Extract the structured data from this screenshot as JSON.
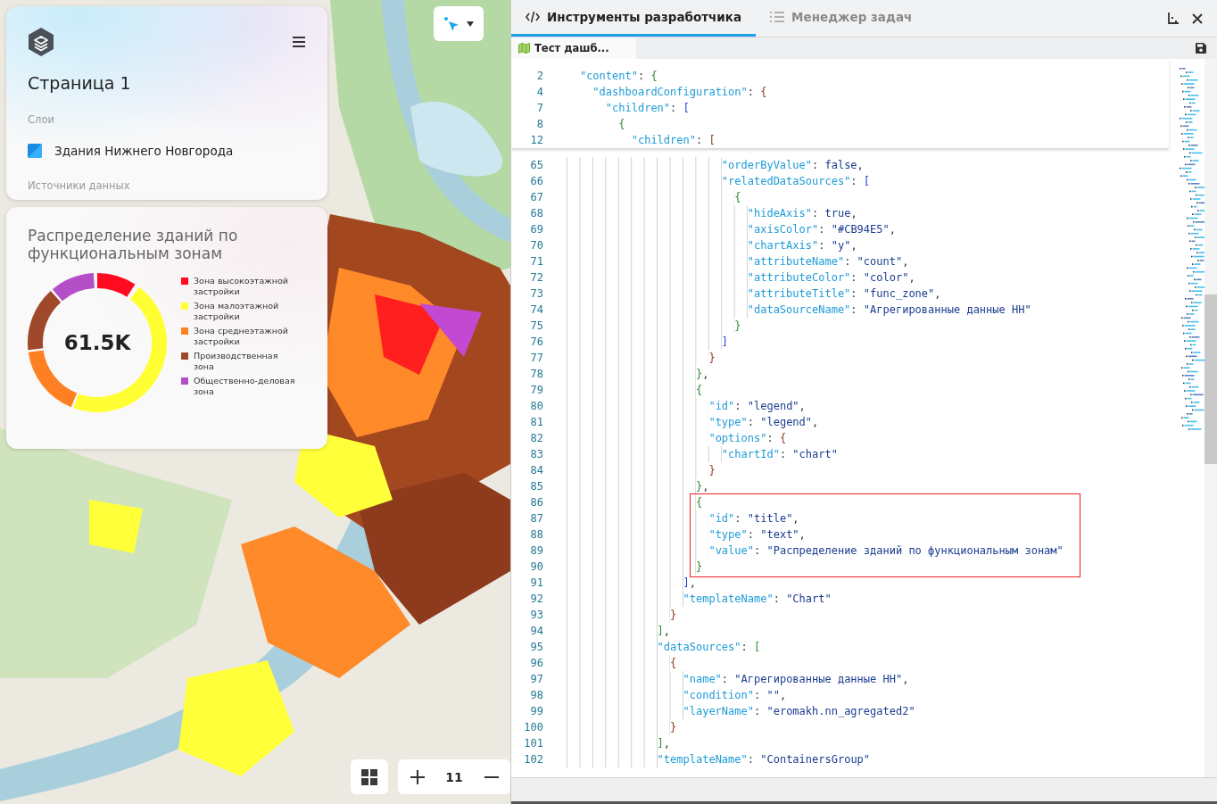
{
  "page_card": {
    "title": "Страница 1",
    "layers_label": "Слои",
    "layers": [
      {
        "name": "Здания Нижнего Новгорода"
      }
    ],
    "sources_label": "Источники данных"
  },
  "chart_card": {
    "title": "Распределение зданий по функциональным зонам",
    "total": "61.5K",
    "legend": [
      {
        "label": "Зона высокоэтажной застройки",
        "color": "#ff0a1e"
      },
      {
        "label": "Зона малоэтажной застройки",
        "color": "#ffff33"
      },
      {
        "label": "Зона среднеэтажной застройки",
        "color": "#ff8022"
      },
      {
        "label": "Производственная зона",
        "color": "#a0482a"
      },
      {
        "label": "Общественно-деловая зона",
        "color": "#b44fc8"
      }
    ]
  },
  "map_controls": {
    "zoom": "11"
  },
  "devtools": {
    "tabs": [
      {
        "label": "Инструменты разработчика",
        "kind": "code",
        "selected": true
      },
      {
        "label": "Менеджер задач",
        "kind": "list",
        "selected": false
      }
    ],
    "file_tabs": [
      {
        "label": "Тест дашб...",
        "selected": true
      }
    ],
    "sticky_lines": [
      {
        "n": "2",
        "code": "    \"content\": {"
      },
      {
        "n": "4",
        "code": "      \"dashboardConfiguration\": {"
      },
      {
        "n": "7",
        "code": "        \"children\": ["
      },
      {
        "n": "8",
        "code": "          {"
      },
      {
        "n": "12",
        "code": "            \"children\": ["
      }
    ],
    "lines": [
      {
        "n": "65",
        "code": "                          \"orderByValue\": false,",
        "highlighted": false
      },
      {
        "n": "66",
        "code": "                          \"relatedDataSources\": [",
        "highlighted": false
      },
      {
        "n": "67",
        "code": "                            {",
        "highlighted": false
      },
      {
        "n": "68",
        "code": "                              \"hideAxis\": true,",
        "highlighted": false
      },
      {
        "n": "69",
        "code": "                              \"axisColor\": \"#CB94E5\",",
        "highlighted": false
      },
      {
        "n": "70",
        "code": "                              \"chartAxis\": \"y\",",
        "highlighted": false
      },
      {
        "n": "71",
        "code": "                              \"attributeName\": \"count\",",
        "highlighted": false
      },
      {
        "n": "72",
        "code": "                              \"attributeColor\": \"color\",",
        "highlighted": false
      },
      {
        "n": "73",
        "code": "                              \"attributeTitle\": \"func_zone\",",
        "highlighted": false
      },
      {
        "n": "74",
        "code": "                              \"dataSourceName\": \"Агрегированные данные НН\"",
        "highlighted": false
      },
      {
        "n": "75",
        "code": "                            }",
        "highlighted": false
      },
      {
        "n": "76",
        "code": "                          ]",
        "highlighted": false
      },
      {
        "n": "77",
        "code": "                        }",
        "highlighted": false
      },
      {
        "n": "78",
        "code": "                      },",
        "highlighted": false
      },
      {
        "n": "79",
        "code": "                      {",
        "highlighted": false
      },
      {
        "n": "80",
        "code": "                        \"id\": \"legend\",",
        "highlighted": false
      },
      {
        "n": "81",
        "code": "                        \"type\": \"legend\",",
        "highlighted": false
      },
      {
        "n": "82",
        "code": "                        \"options\": {",
        "highlighted": false
      },
      {
        "n": "83",
        "code": "                          \"chartId\": \"chart\"",
        "highlighted": false
      },
      {
        "n": "84",
        "code": "                        }",
        "highlighted": false
      },
      {
        "n": "85",
        "code": "                      },",
        "highlighted": false
      },
      {
        "n": "86",
        "code": "                      {",
        "highlighted": true
      },
      {
        "n": "87",
        "code": "                        \"id\": \"title\",",
        "highlighted": true
      },
      {
        "n": "88",
        "code": "                        \"type\": \"text\",",
        "highlighted": true
      },
      {
        "n": "89",
        "code": "                        \"value\": \"Распределение зданий по функциональным зонам\"",
        "highlighted": true
      },
      {
        "n": "90",
        "code": "                      }",
        "highlighted": true
      },
      {
        "n": "91",
        "code": "                    ],",
        "highlighted": false
      },
      {
        "n": "92",
        "code": "                    \"templateName\": \"Chart\"",
        "highlighted": false
      },
      {
        "n": "93",
        "code": "                  }",
        "highlighted": false
      },
      {
        "n": "94",
        "code": "                ],",
        "highlighted": false
      },
      {
        "n": "95",
        "code": "                \"dataSources\": [",
        "highlighted": false
      },
      {
        "n": "96",
        "code": "                  {",
        "highlighted": false
      },
      {
        "n": "97",
        "code": "                    \"name\": \"Агрегированные данные НН\",",
        "highlighted": false
      },
      {
        "n": "98",
        "code": "                    \"condition\": \"\",",
        "highlighted": false
      },
      {
        "n": "99",
        "code": "                    \"layerName\": \"eromakh.nn_agregated2\"",
        "highlighted": false
      },
      {
        "n": "100",
        "code": "                  }",
        "highlighted": false
      },
      {
        "n": "101",
        "code": "                ],",
        "highlighted": false
      },
      {
        "n": "102",
        "code": "                \"templateName\": \"ContainersGroup\"",
        "highlighted": false
      }
    ]
  }
}
